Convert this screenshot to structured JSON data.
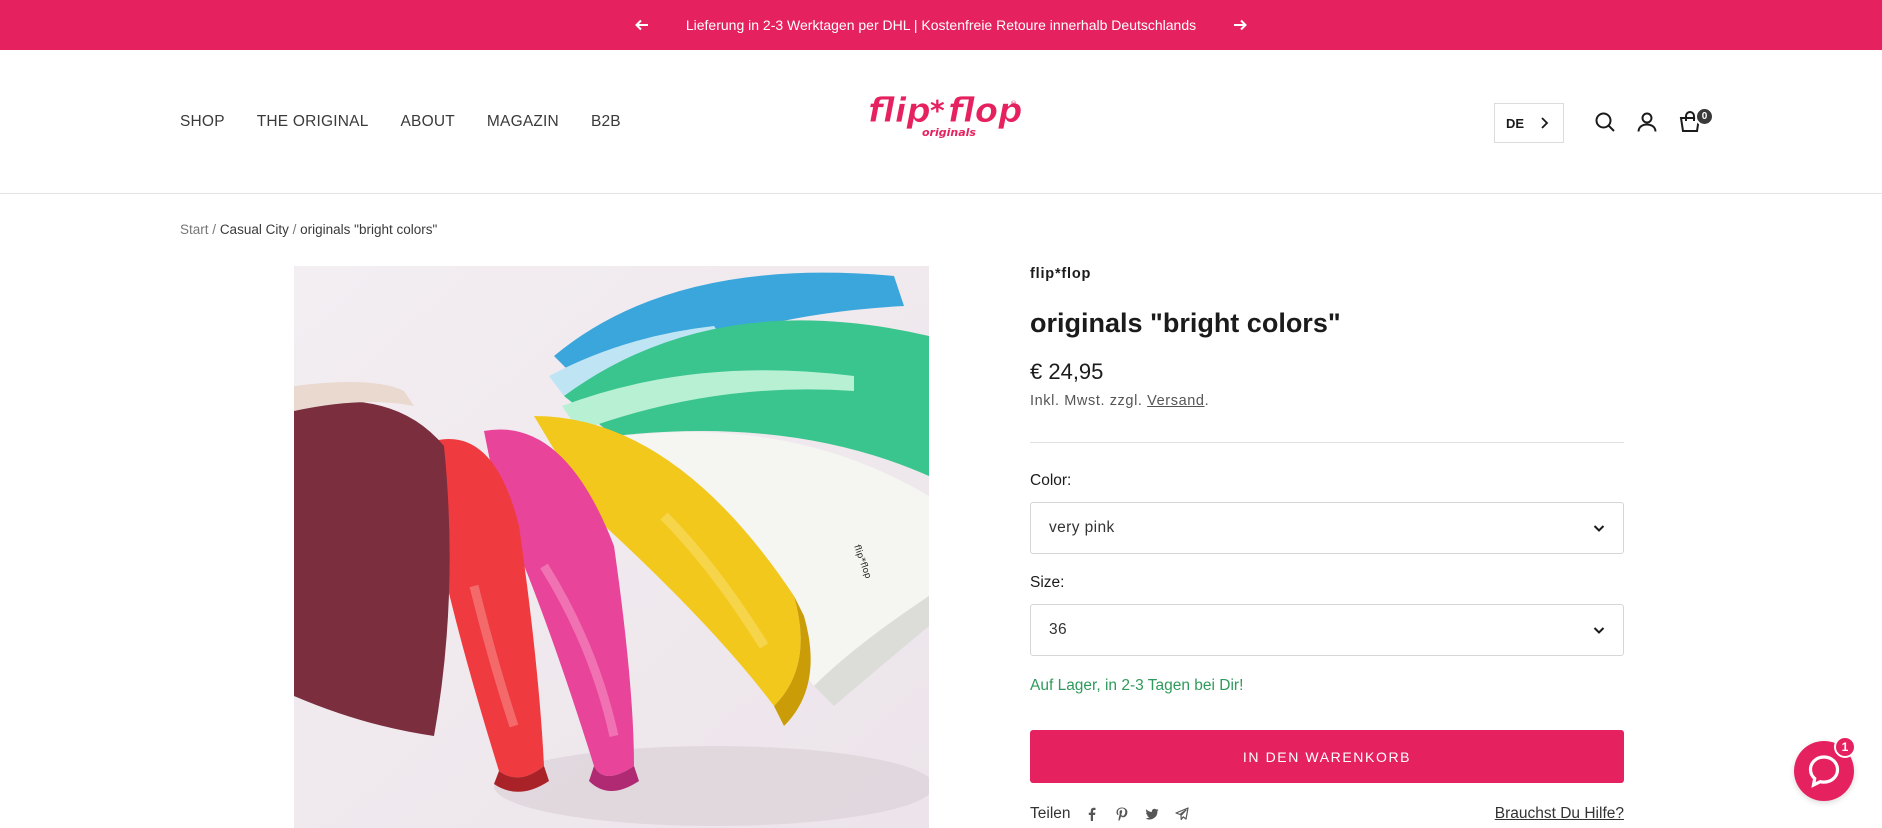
{
  "announcement": {
    "text": "Lieferung in 2-3 Werktagen per DHL | Kostenfreie Retoure innerhalb Deutschlands",
    "prev_icon": "arrow-left-icon",
    "next_icon": "arrow-right-icon"
  },
  "header": {
    "nav": [
      "SHOP",
      "THE ORIGINAL",
      "ABOUT",
      "MAGAZIN",
      "B2B"
    ],
    "logo_text": "flip*flop",
    "logo_sub": "originals",
    "language": "DE",
    "cart_count": "0",
    "icons": [
      "search-icon",
      "account-icon",
      "cart-icon"
    ]
  },
  "breadcrumb": {
    "items": [
      "Start",
      "Casual City",
      "originals \"bright colors\""
    ],
    "separator": "/"
  },
  "product": {
    "vendor": "flip*flop",
    "title": "originals \"bright colors\"",
    "price": "€ 24,95",
    "tax_prefix": "Inkl. Mwst. zzgl. ",
    "tax_link": "Versand",
    "tax_suffix": ".",
    "color_label": "Color:",
    "color_value": "very pink",
    "size_label": "Size:",
    "size_value": "36",
    "stock": "Auf Lager, in 2-3 Tagen bei Dir!",
    "add_to_cart": "IN DEN WARENKORB",
    "share_label": "Teilen",
    "share_icons": [
      "facebook-icon",
      "pinterest-icon",
      "twitter-icon",
      "telegram-icon"
    ],
    "help_link": "Brauchst Du Hilfe?"
  },
  "chat": {
    "badge": "1"
  },
  "colors": {
    "brand": "#e6215f",
    "stock_green": "#2f9a5b",
    "text": "#1c1b1b"
  }
}
